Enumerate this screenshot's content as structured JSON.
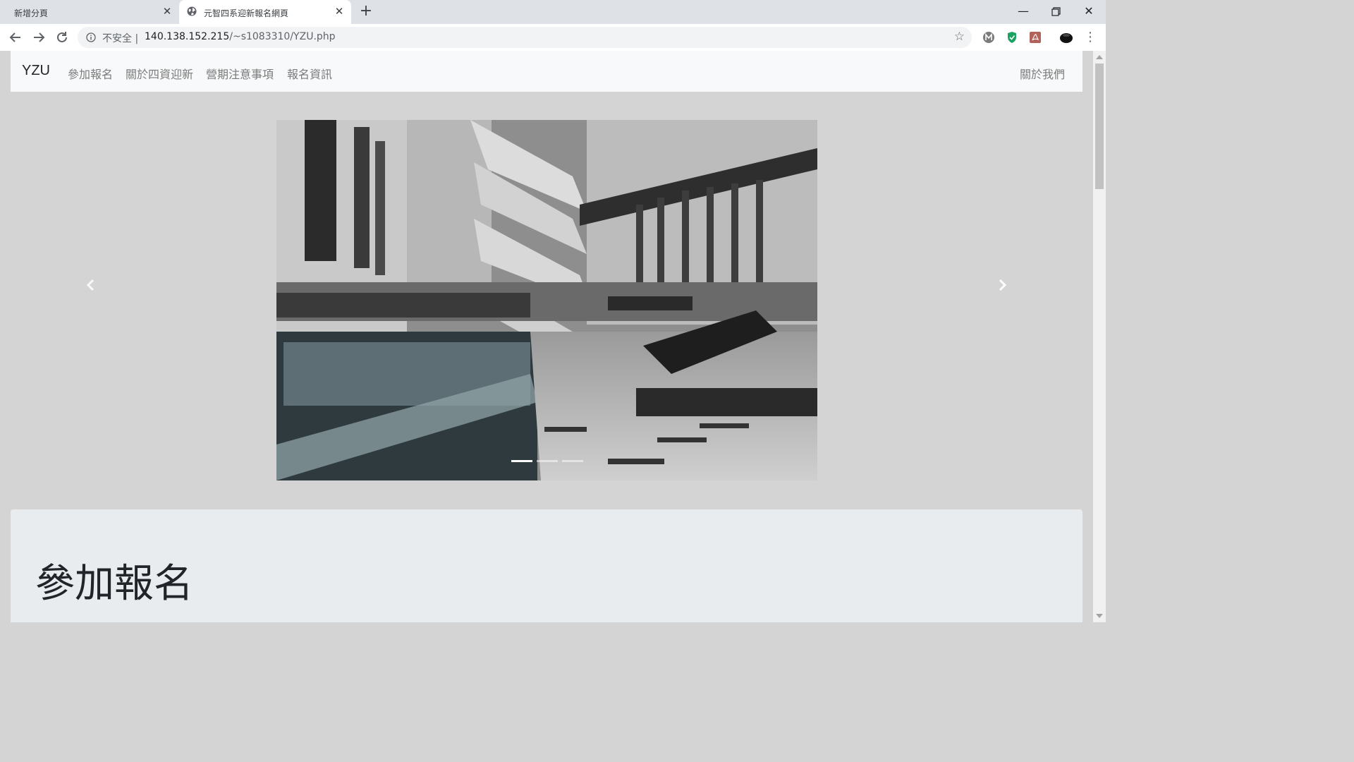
{
  "browser": {
    "tabs": [
      {
        "title": "新增分頁"
      },
      {
        "title": "元智四系迎新報名網頁"
      }
    ],
    "address": {
      "security_label": "不安全",
      "url_host": "140.138.152.215",
      "url_path": "/~s1083310/YZU.php"
    }
  },
  "navbar": {
    "brand": "YZU",
    "links": [
      "參加報名",
      "關於四資迎新",
      "營期注意事項",
      "報名資訊"
    ],
    "right_link": "關於我們"
  },
  "carousel": {
    "slides": 3,
    "active_index": 0
  },
  "section": {
    "heading": "參加報名"
  }
}
